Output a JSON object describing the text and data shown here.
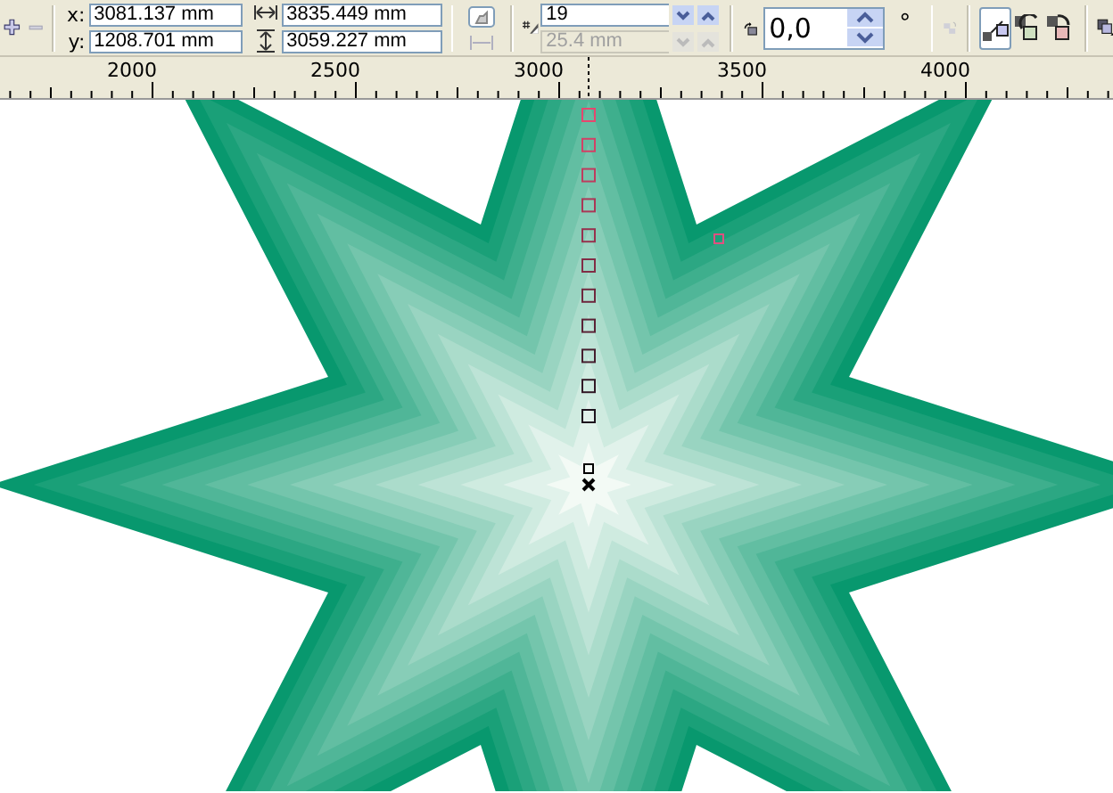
{
  "property_bar": {
    "position": {
      "x_label": "x:",
      "x_value": "3081.137 mm",
      "y_label": "y:",
      "y_value": "1208.701 mm"
    },
    "size": {
      "width_value": "3835.449 mm",
      "height_value": "3059.227 mm"
    },
    "blend_steps": {
      "value": "19",
      "disabled": false
    },
    "blend_spacing": {
      "value": "25.4 mm",
      "disabled": true
    },
    "blend_angle": {
      "value": "0,0",
      "unit": "°"
    },
    "color_direction": [
      {
        "kind": "direct",
        "selected": true
      },
      {
        "kind": "clockwise",
        "selected": false
      },
      {
        "kind": "counterclockwise",
        "selected": false
      }
    ]
  },
  "ruler": {
    "labels": [
      "2000",
      "2500",
      "3000",
      "3500",
      "4000"
    ]
  }
}
